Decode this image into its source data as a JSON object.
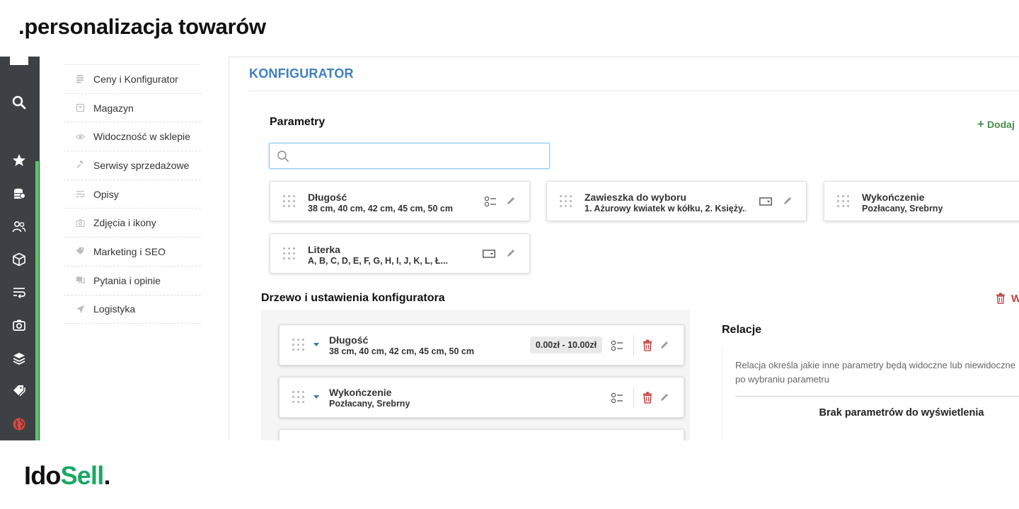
{
  "page_title": ".personalizacja towarów",
  "brand": {
    "part1": "Ido",
    "part2": "Sell",
    "part3": "."
  },
  "rail": {
    "icons": [
      "menu-square-icon",
      "search-icon",
      "star-icon",
      "coins-icon",
      "users-icon",
      "box-icon",
      "text-wrap-icon",
      "camera-icon",
      "layers-icon",
      "tags-icon",
      "globe-icon"
    ],
    "accent_color": "#5cc46a"
  },
  "submenu": {
    "items": [
      {
        "label": "Ceny i Konfigurator",
        "icon": "price-list-icon"
      },
      {
        "label": "Magazyn",
        "icon": "warehouse-icon"
      },
      {
        "label": "Widoczność w sklepie",
        "icon": "eye-icon"
      },
      {
        "label": "Serwisy sprzedażowe",
        "icon": "gavel-icon"
      },
      {
        "label": "Opisy",
        "icon": "text-lines-icon"
      },
      {
        "label": "Zdjęcia i ikony",
        "icon": "camera-icon"
      },
      {
        "label": "Marketing i SEO",
        "icon": "tag-icon"
      },
      {
        "label": "Pytania i opinie",
        "icon": "chat-icon"
      },
      {
        "label": "Logistyka",
        "icon": "send-icon"
      }
    ]
  },
  "main": {
    "section_title": "KONFIGURATOR",
    "params_label": "Parametry",
    "add_label": "Dodaj",
    "search": {
      "placeholder": "",
      "value": ""
    },
    "param_cards": [
      {
        "name": "Długość",
        "values": "38 cm, 40 cm, 42 cm, 45 cm, 50 cm",
        "type_icon": "list-icon"
      },
      {
        "name": "Zawieszka do wyboru",
        "values": "1. Ażurowy kwiatek w kółku, 2. Księży...",
        "type_icon": "select-box-icon"
      },
      {
        "name": "Wykończenie",
        "values": "Pozłacany, Srebrny",
        "type_icon": "list-icon"
      },
      {
        "name": "Literka",
        "values": "A, B, C, D, E, F, G, H, I, J, K, L, Ł...",
        "type_icon": "select-box-icon"
      }
    ],
    "tree_label": "Drzewo i ustawienia konfiguratora",
    "tree_delete_label": "W",
    "tree_items": [
      {
        "name": "Długość",
        "values": "38 cm, 40 cm, 42 cm, 45 cm, 50 cm",
        "price": "0.00zł - 10.00zł"
      },
      {
        "name": "Wykończenie",
        "values": "Pozłacany, Srebrny",
        "price": ""
      }
    ],
    "relations": {
      "label": "Relacje",
      "description": "Relacja określa jakie inne parametry będą widoczne lub niewidoczne po wybraniu parametru",
      "empty": "Brak parametrów do wyświetlenia"
    }
  },
  "colors": {
    "section_title": "#3f7fbf",
    "add_green": "#4e8a4e",
    "delete_red": "#c04040",
    "brand_green": "#1aa864",
    "rail_bg": "#3d4044"
  }
}
